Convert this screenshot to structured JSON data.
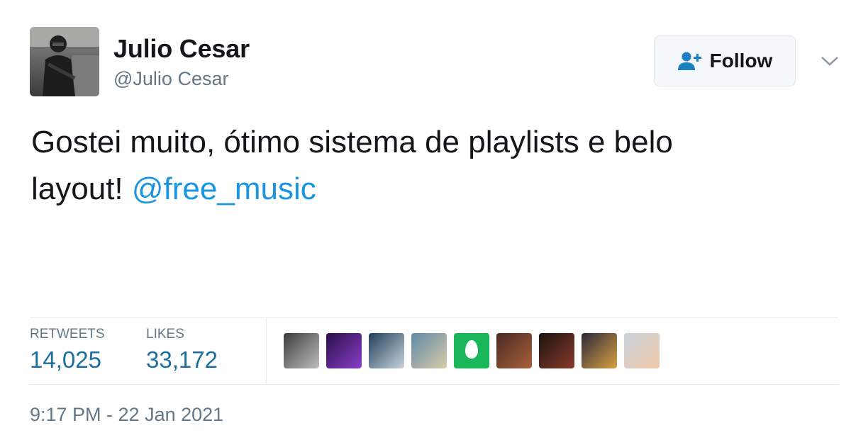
{
  "author": {
    "display_name": "Julio Cesar",
    "handle": "@Julio Cesar",
    "avatar_icon": "avatar-icon"
  },
  "follow": {
    "label": "Follow",
    "icon": "add-user-icon",
    "menu_icon": "chevron-down-icon"
  },
  "tweet": {
    "text_line1": "Gostei muito, ótimo sistema de playlists e belo",
    "text_line2": "layout! ",
    "mention": "@free_music"
  },
  "stats": {
    "retweets_label": "RETWEETS",
    "retweets_value": "14,025",
    "likes_label": "LIKES",
    "likes_value": "33,172"
  },
  "likers": [
    {
      "name": "liker-avatar-1",
      "colors": [
        "#3b3b3b",
        "#bfbfbf"
      ]
    },
    {
      "name": "liker-avatar-2",
      "colors": [
        "#2a0f4a",
        "#8a3ec8"
      ]
    },
    {
      "name": "liker-avatar-3",
      "colors": [
        "#1f3f5a",
        "#c9d4dc"
      ]
    },
    {
      "name": "liker-avatar-4",
      "colors": [
        "#5f8aa6",
        "#d9c9a8"
      ]
    },
    {
      "name": "liker-avatar-5",
      "colors": [
        "#19b65a",
        "#ffffff"
      ]
    },
    {
      "name": "liker-avatar-6",
      "colors": [
        "#4a2a22",
        "#a8603d"
      ]
    },
    {
      "name": "liker-avatar-7",
      "colors": [
        "#1a1410",
        "#8a3a2c"
      ]
    },
    {
      "name": "liker-avatar-8",
      "colors": [
        "#2a2a3a",
        "#d9a040"
      ]
    },
    {
      "name": "liker-avatar-9",
      "colors": [
        "#c8d0dc",
        "#f0c8a8"
      ]
    }
  ],
  "timestamp": "9:17 PM - 22 Jan 2021",
  "colors": {
    "mention": "#1b95e0",
    "secondary_text": "#657786",
    "stat_value": "#1b6f9e"
  }
}
